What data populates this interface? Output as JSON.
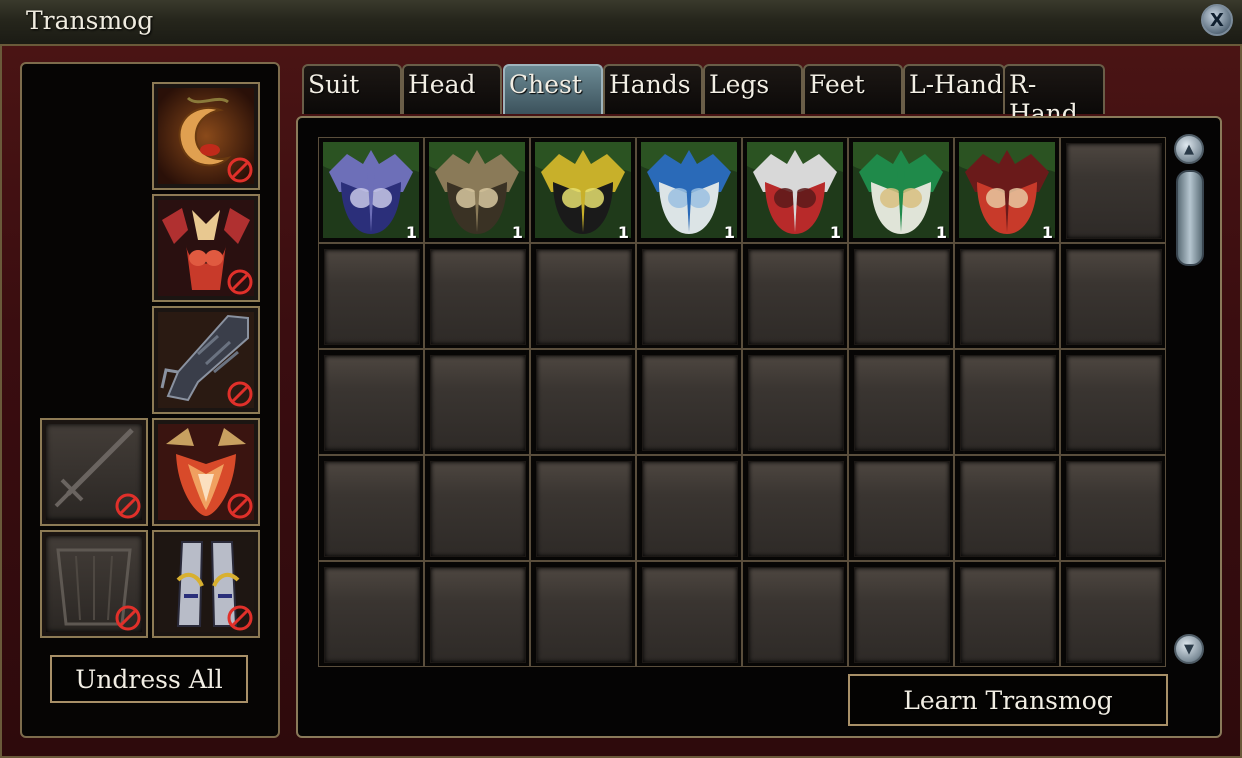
{
  "window": {
    "title": "Transmog",
    "close_label": "X"
  },
  "tabs": [
    {
      "label": "Suit",
      "active": false
    },
    {
      "label": "Head",
      "active": false
    },
    {
      "label": "Chest",
      "active": true
    },
    {
      "label": "Hands",
      "active": false
    },
    {
      "label": "Legs",
      "active": false
    },
    {
      "label": "Feet",
      "active": false
    },
    {
      "label": "L-Hand",
      "active": false
    },
    {
      "label": "R-Hand",
      "active": false
    }
  ],
  "equipment_slots": [
    {
      "slot": "head",
      "item": "crescent-headpiece",
      "disabled_marker": true
    },
    {
      "slot": "chest",
      "item": "red-armor-chest",
      "disabled_marker": true
    },
    {
      "slot": "hands",
      "item": "dark-gauntlets",
      "disabled_marker": true
    },
    {
      "slot": "l-hand",
      "item": "sword-placeholder",
      "empty": true,
      "disabled_marker": true
    },
    {
      "slot": "legs",
      "item": "flame-leg-armor",
      "disabled_marker": true
    },
    {
      "slot": "r-hand",
      "item": "shield-placeholder",
      "empty": true,
      "disabled_marker": true
    },
    {
      "slot": "feet",
      "item": "silver-gold-boots",
      "disabled_marker": true
    }
  ],
  "buttons": {
    "undress_all": "Undress All",
    "learn_transmog": "Learn Transmog"
  },
  "inventory": {
    "columns": 8,
    "rows": 5,
    "items": [
      {
        "name": "blue-chest-armor",
        "count": "1",
        "colors": [
          "#2b2f7a",
          "#6d6fb8",
          "#c8c8e8"
        ]
      },
      {
        "name": "gold-black-chest-armor",
        "count": "1",
        "colors": [
          "#3a3224",
          "#8a7a58",
          "#d8c8a0"
        ]
      },
      {
        "name": "yellow-chest-armor",
        "count": "1",
        "colors": [
          "#1a1a1a",
          "#c8b02a",
          "#e6e070"
        ]
      },
      {
        "name": "white-blue-chest-armor",
        "count": "1",
        "colors": [
          "#dce4e6",
          "#2a6ab8",
          "#9ac0e0"
        ]
      },
      {
        "name": "red-silver-chest-armor",
        "count": "1",
        "colors": [
          "#b82a2a",
          "#d8d8d8",
          "#5a1a1a"
        ]
      },
      {
        "name": "white-green-chest-armor",
        "count": "1",
        "colors": [
          "#e0e4d8",
          "#1f8a4a",
          "#d8c080"
        ]
      },
      {
        "name": "red-dragon-chest-armor",
        "count": "1",
        "colors": [
          "#c83a2a",
          "#6a1a1a",
          "#e8c8a0"
        ]
      }
    ]
  },
  "scrollbar": {
    "up_label": "▲",
    "down_label": "▼"
  }
}
